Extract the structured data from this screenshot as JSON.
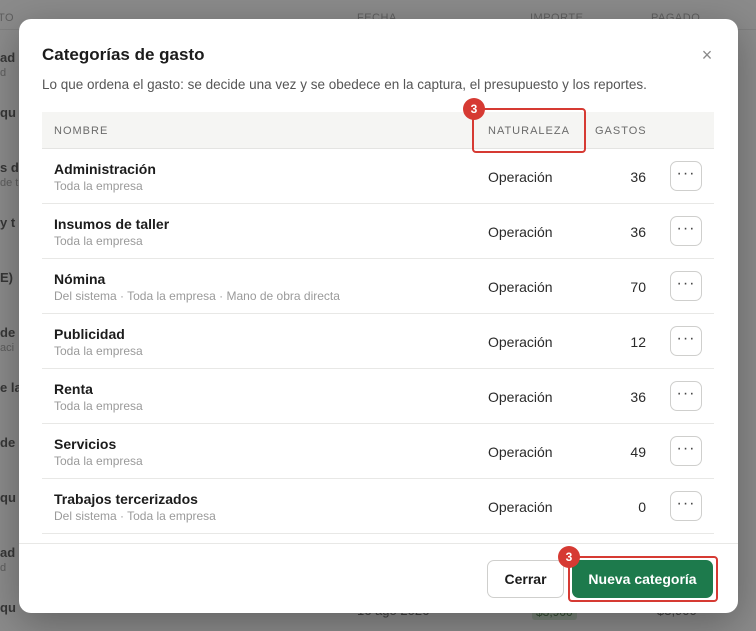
{
  "background": {
    "header_cols": [
      "TO",
      "FECHA",
      "IMPORTE",
      "PAGADO"
    ],
    "fragments": [
      {
        "title": "ad",
        "sub": "d"
      },
      {
        "title": "qu",
        "sub": ""
      },
      {
        "title": "s de",
        "sub": "de t"
      },
      {
        "title": "y t",
        "sub": ""
      },
      {
        "title": "E)",
        "sub": ""
      },
      {
        "title": "de r",
        "sub": "aci"
      },
      {
        "title": "e la",
        "sub": ""
      },
      {
        "title": "de",
        "sub": ""
      },
      {
        "title": "qu",
        "sub": ""
      },
      {
        "title": "ad",
        "sub": "d"
      },
      {
        "title": "qu",
        "sub": ""
      }
    ],
    "bottom_date": "16 ago 2026",
    "bottom_amount_pill": "$3,900",
    "bottom_amount": "$3,900"
  },
  "dialog": {
    "title": "Categorías de gasto",
    "close_icon": "×",
    "description": "Lo que ordena el gasto: se decide una vez y se obedece en la captura, el presupuesto y los reportes.",
    "columns": {
      "name": "NOMBRE",
      "nature": "NATURALEZA",
      "count": "GASTOS"
    },
    "rows": [
      {
        "name": "Administración",
        "sub": "Toda la empresa",
        "nature": "Operación",
        "count": "36"
      },
      {
        "name": "Insumos de taller",
        "sub": "Toda la empresa",
        "nature": "Operación",
        "count": "36"
      },
      {
        "name": "Nómina",
        "sub": "Del sistema · Toda la empresa · Mano de obra directa",
        "nature": "Operación",
        "count": "70"
      },
      {
        "name": "Publicidad",
        "sub": "Toda la empresa",
        "nature": "Operación",
        "count": "12"
      },
      {
        "name": "Renta",
        "sub": "Toda la empresa",
        "nature": "Operación",
        "count": "36"
      },
      {
        "name": "Servicios",
        "sub": "Toda la empresa",
        "nature": "Operación",
        "count": "49"
      },
      {
        "name": "Trabajos tercerizados",
        "sub": "Del sistema · Toda la empresa",
        "nature": "Operación",
        "count": "0"
      }
    ],
    "more_icon": "···",
    "close_button": "Cerrar",
    "new_button": "Nueva categoría"
  },
  "annotations": {
    "badge_nature": "3",
    "badge_new": "3"
  },
  "colors": {
    "primary": "#1d7a4c",
    "highlight": "#d63a33"
  }
}
